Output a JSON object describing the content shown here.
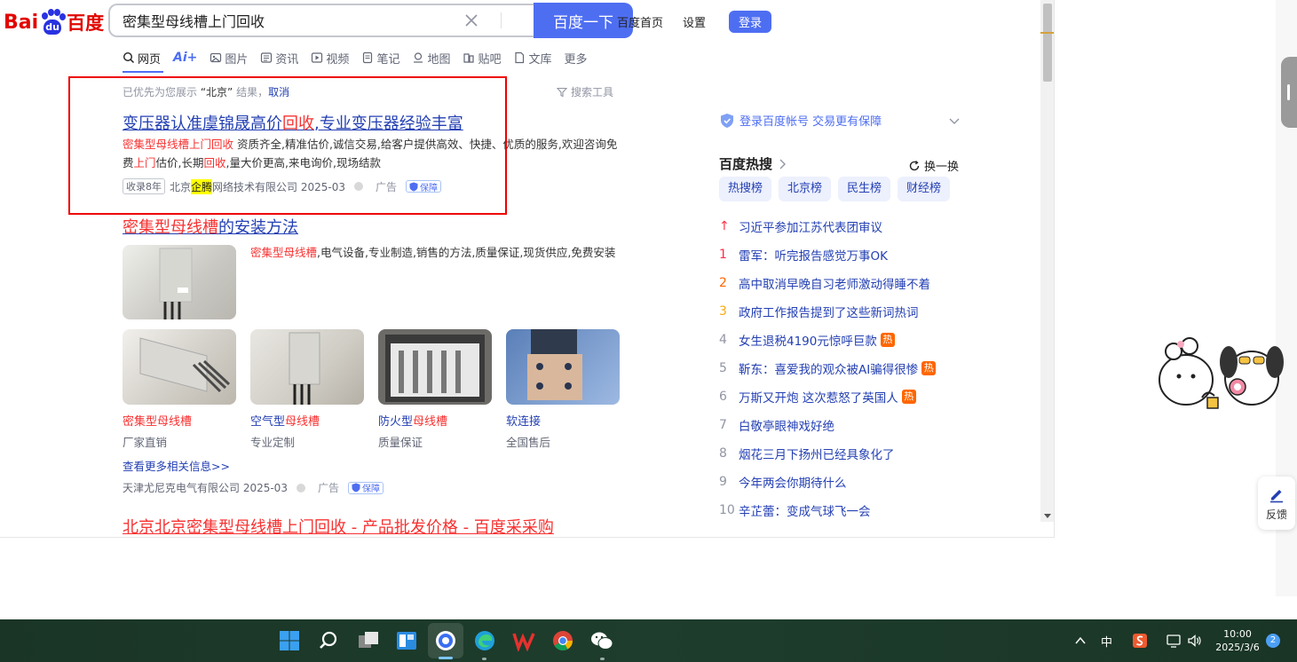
{
  "header": {
    "logo_bai": "Bai",
    "logo_du": "du",
    "logo_cn": "百度",
    "search_value": "密集型母线槽上门回收",
    "search_button": "百度一下",
    "links": [
      "百度首页",
      "设置"
    ],
    "login": "登录"
  },
  "tabs": [
    {
      "label": "网页",
      "icon": "search-icon"
    },
    {
      "label": "Ai+",
      "icon": "ai-icon"
    },
    {
      "label": "图片",
      "icon": "image-icon"
    },
    {
      "label": "资讯",
      "icon": "news-icon"
    },
    {
      "label": "视频",
      "icon": "video-icon"
    },
    {
      "label": "笔记",
      "icon": "note-icon"
    },
    {
      "label": "地图",
      "icon": "map-icon"
    },
    {
      "label": "贴吧",
      "icon": "tieba-icon"
    },
    {
      "label": "文库",
      "icon": "doc-icon"
    },
    {
      "label": "更多",
      "icon": ""
    }
  ],
  "notice": {
    "prefix": "已优先为您展示",
    "query": "“北京”",
    "suffix": "结果，",
    "cancel": "取消",
    "tools": "搜索工具"
  },
  "result1": {
    "title_a": "变压器认准虞锦晟高价",
    "title_hl": "回收",
    "title_b": ",专业变压器经验丰富",
    "abs_hl1": "密集型母线槽上门回收",
    "abs_a": " 资质齐全,精准估价,诚信交易,给客户提供高效、快捷、优质的服务,欢迎咨询免费",
    "abs_hl2": "上门",
    "abs_b": "估价,长期",
    "abs_hl3": "回收",
    "abs_c": ",量大价更高,来电询价,现场结款",
    "age": "收录8年",
    "company_a": "北京",
    "company_hl": "企腾",
    "company_b": "网络技术有限公司 2025-03",
    "ad": "广告",
    "guarantee": "保障"
  },
  "result2": {
    "title_hl": "密集型母线槽",
    "title_b": "的安装方法",
    "abs_hl": "密集型母线槽",
    "abs_b": ",电气设备,专业制造,销售的方法,质量保证,现货供应,免费安装",
    "products": [
      {
        "name_hl": "密集型母线槽",
        "name_b": "",
        "sub": "厂家直销"
      },
      {
        "name_hl": "",
        "name_pre": "空气型",
        "name_b": "母线槽",
        "sub": "专业定制"
      },
      {
        "name_hl": "",
        "name_pre": "防火型",
        "name_b": "母线槽",
        "sub": "质量保证"
      },
      {
        "name_hl": "",
        "name_pre": "软连接",
        "name_b": "",
        "sub": "全国售后"
      }
    ],
    "more": "查看更多相关信息>>",
    "company": "天津尤尼克电气有限公司 2025-03",
    "ad": "广告",
    "guarantee": "保障"
  },
  "result3": {
    "title": "北京北京密集型母线槽上门回收 - 产品批发价格 - 百度采采购"
  },
  "right": {
    "login_tip": "登录百度帐号 交易更有保障",
    "hot_title": "百度热搜",
    "refresh": "换一换",
    "hot_tabs": [
      "热搜榜",
      "北京榜",
      "民生榜",
      "财经榜"
    ],
    "hot_items": [
      {
        "rank": "↑",
        "text": "习近平参加江苏代表团审议",
        "tag": ""
      },
      {
        "rank": "1",
        "text": "雷军：听完报告感觉万事OK",
        "tag": ""
      },
      {
        "rank": "2",
        "text": "高中取消早晚自习老师激动得睡不着",
        "tag": ""
      },
      {
        "rank": "3",
        "text": "政府工作报告提到了这些新词热词",
        "tag": ""
      },
      {
        "rank": "4",
        "text": "女生退税4190元惊呼巨款",
        "tag": "热"
      },
      {
        "rank": "5",
        "text": "靳东：喜爱我的观众被AI骗得很惨",
        "tag": "热"
      },
      {
        "rank": "6",
        "text": "万斯又开炮 这次惹怒了英国人",
        "tag": "热"
      },
      {
        "rank": "7",
        "text": "白敬亭眼神戏好绝",
        "tag": ""
      },
      {
        "rank": "8",
        "text": "烟花三月下扬州已经具象化了",
        "tag": ""
      },
      {
        "rank": "9",
        "text": "今年两会你期待什么",
        "tag": ""
      },
      {
        "rank": "10",
        "text": "辛芷蕾：变成气球飞一会",
        "tag": ""
      }
    ],
    "feedback": "反馈"
  },
  "taskbar": {
    "ime": "中",
    "time": "10:00",
    "date": "2025/3/6",
    "notifications": "2"
  },
  "colors": {
    "brand_blue": "#4e6ef2",
    "link_blue": "#2440b3",
    "highlight_red": "#f73131",
    "annotation_red": "#ee0000"
  }
}
